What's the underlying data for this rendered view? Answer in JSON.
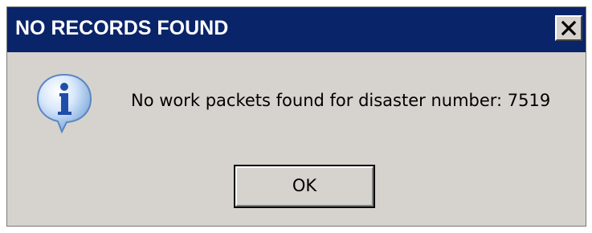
{
  "dialog": {
    "title": "NO RECORDS FOUND",
    "close_label": "×",
    "icon": "information-icon",
    "message": "No work packets found for disaster number: 7519",
    "ok_label": "OK"
  },
  "colors": {
    "titlebar": "#0a246a",
    "dialog_bg": "#d6d3ce",
    "title_text": "#ffffff"
  }
}
